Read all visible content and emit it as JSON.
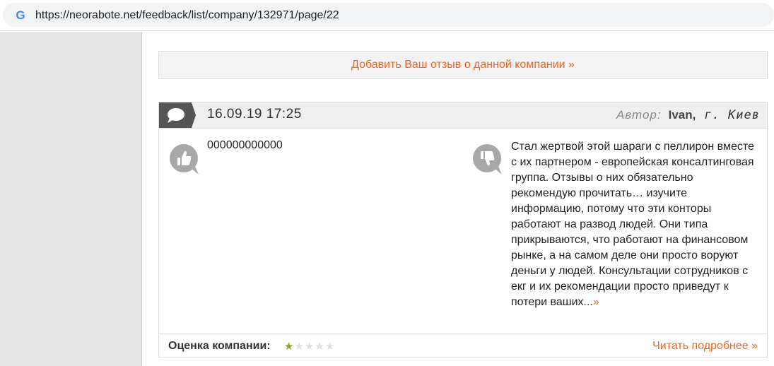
{
  "browser": {
    "url": "https://neorabote.net/feedback/list/company/132971/page/22"
  },
  "add_review": {
    "label": "Добавить Ваш отзыв о данной компании »"
  },
  "review": {
    "date": "16.09.19 17:25",
    "author_label": "Автор:",
    "author_name": "Ivan,",
    "author_city": "г. Киев",
    "positive_text": "000000000000",
    "negative_text": "Стал жертвой этой шараги с пеллирон вместе с их партнером - европейская консалтинговая группа. Отзывы о них обязательно рекомендую прочитать… изучите информацию, потому что эти конторы работают на развод людей. Они типа прикрываются, что работают на финансовом рынке, а на самом деле они просто воруют деньги у людей. Консультации сотрудников с екг и их рекомендации просто приведут к потери ваших...",
    "negative_more": "»",
    "rating_label": "Оценка компании:",
    "rating": 1,
    "rating_max": 5,
    "read_more": "Читать подробнее »"
  },
  "colors": {
    "accent": "#f26522",
    "star_on": "#8aa928",
    "star_off": "#e0e0e0"
  }
}
